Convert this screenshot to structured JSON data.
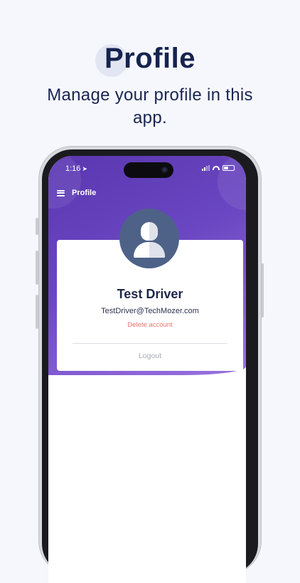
{
  "promo": {
    "title": "Profile",
    "subtitle": "Manage your profile in this app."
  },
  "status_bar": {
    "time": "1:16",
    "location_icon": "navigation-arrow-icon",
    "signal_icon": "cellular-signal-icon",
    "wifi_icon": "wifi-icon",
    "battery_icon": "battery-icon"
  },
  "app_bar": {
    "menu_icon": "hamburger-menu-icon",
    "title": "Profile"
  },
  "profile": {
    "avatar_icon": "user-avatar-icon",
    "name": "Test Driver",
    "email": "TestDriver@TechMozer.com",
    "delete_label": "Delete account",
    "logout_label": "Logout"
  },
  "colors": {
    "background": "#f5f7fd",
    "heading": "#15234f",
    "hero_gradient_start": "#5a37b0",
    "hero_gradient_end": "#9a74df",
    "avatar": "#4e6288",
    "delete": "#e8736b",
    "logout": "#a7a9b3"
  }
}
